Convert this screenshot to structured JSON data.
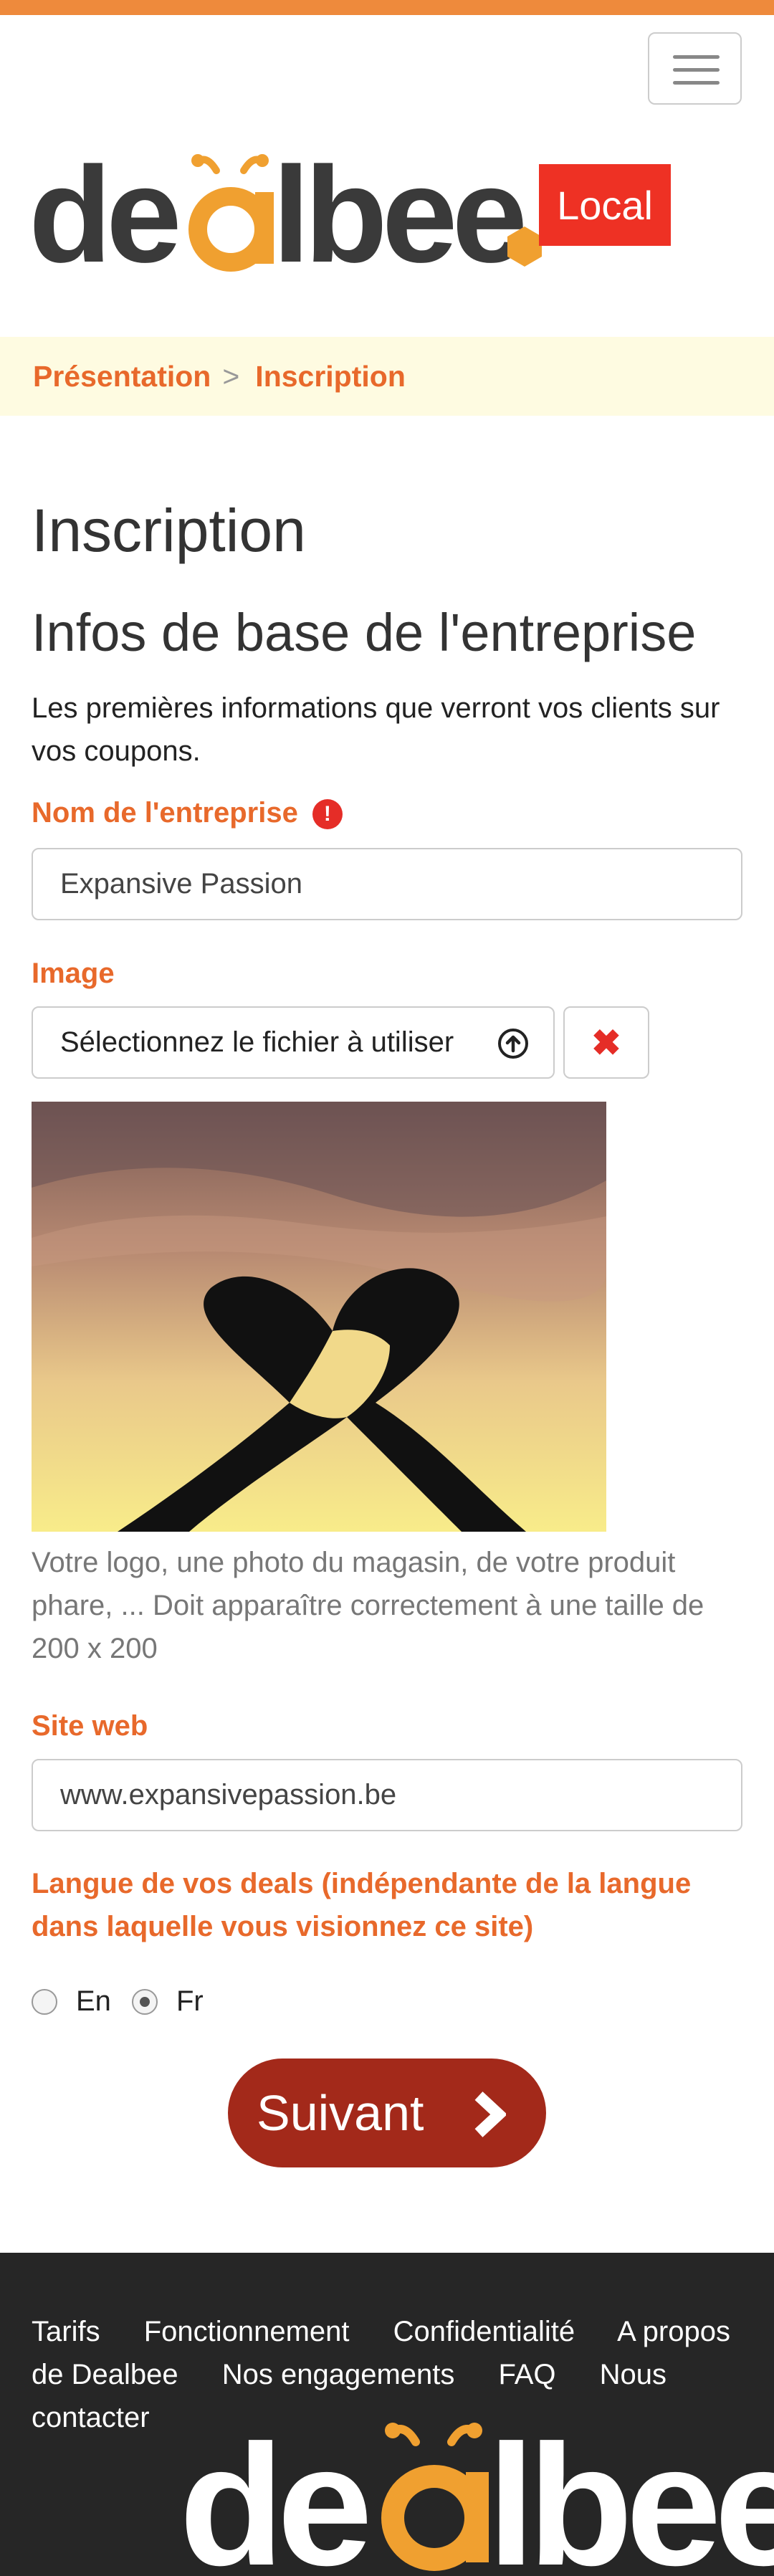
{
  "header": {
    "brand": "dealbee",
    "badge": "Local",
    "accent_color": "#ee8a3c",
    "badge_color": "#ee3124",
    "menu_icon": "hamburger-menu-icon"
  },
  "breadcrumb": {
    "items": [
      "Présentation",
      "Inscription"
    ],
    "separator": ">"
  },
  "page": {
    "title": "Inscription",
    "section_title": "Infos de base de l'entreprise",
    "intro": "Les premières informations que verront vos clients sur vos coupons."
  },
  "form": {
    "company_name": {
      "label": "Nom de l'entreprise",
      "value": "Expansive Passion",
      "required_icon": "exclamation-circle-icon"
    },
    "image": {
      "label": "Image",
      "file_button": "Sélectionnez le fichier à utiliser",
      "upload_icon": "upload-circle-icon",
      "clear_icon": "close-x-icon",
      "help": "Votre logo, une photo du magasin, de votre produit phare, ... Doit apparaître correctement à une taille de 200 x 200"
    },
    "website": {
      "label": "Site web",
      "value": "www.expansivepassion.be"
    },
    "language": {
      "label": "Langue de vos deals (indépendante de la langue dans laquelle vous visionnez ce site)",
      "options": [
        "En",
        "Fr"
      ],
      "selected": "Fr"
    },
    "next_button": "Suivant",
    "next_icon": "chevron-right-icon",
    "next_color": "#a3291a"
  },
  "footer": {
    "links": [
      "Tarifs",
      "Fonctionnement",
      "Confidentialité",
      "A propos de Dealbee",
      "Nos engagements",
      "FAQ",
      "Nous contacter"
    ],
    "brand": "dealbee"
  }
}
